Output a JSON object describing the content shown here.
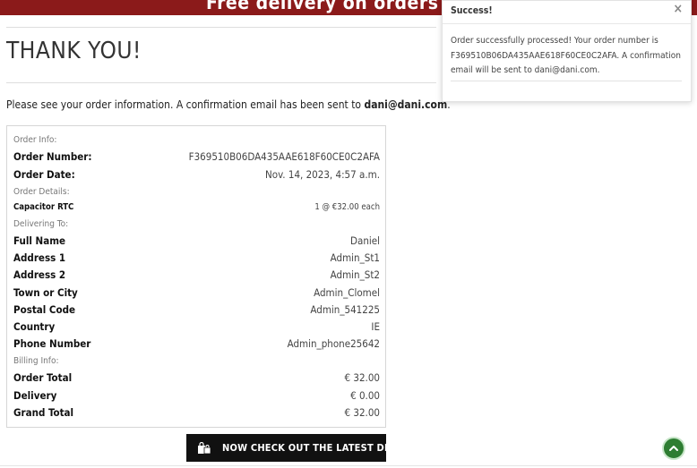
{
  "banner": {
    "text": "Free delivery on orders over €"
  },
  "header": {
    "title": "THANK YOU!"
  },
  "intro": {
    "text": "Please see your order information. A confirmation email has been sent to ",
    "email": "dani@dani.com",
    "suffix": "."
  },
  "order": {
    "order_info_heading": "Order Info:",
    "order_number_label": "Order Number:",
    "order_number": "F369510B06DA435AAE618F60CE0C2AFA",
    "order_date_label": "Order Date:",
    "order_date": "Nov. 14, 2023, 4:57 a.m.",
    "order_details_heading": "Order Details:",
    "items": [
      {
        "name": "Capacitor RTC",
        "detail": "1 @ €32.00 each"
      }
    ],
    "delivering_heading": "Delivering To:",
    "delivery": [
      {
        "label": "Full Name",
        "value": "Daniel"
      },
      {
        "label": "Address 1",
        "value": "Admin_St1"
      },
      {
        "label": "Address 2",
        "value": "Admin_St2"
      },
      {
        "label": "Town or City",
        "value": "Admin_Clomel"
      },
      {
        "label": "Postal Code",
        "value": "Admin_541225"
      },
      {
        "label": "Country",
        "value": "IE"
      },
      {
        "label": "Phone Number",
        "value": "Admin_phone25642"
      }
    ],
    "billing_heading": "Billing Info:",
    "billing": [
      {
        "label": "Order Total",
        "value": "€ 32.00"
      },
      {
        "label": "Delivery",
        "value": "€ 0.00"
      },
      {
        "label": "Grand Total",
        "value": "€ 32.00"
      }
    ]
  },
  "deals_button": {
    "label": "NOW CHECK OUT THE LATEST DEALS!",
    "icon": "shopping-bags-icon"
  },
  "toast": {
    "title": "Success!",
    "close": "×",
    "message": "Order successfully processed! Your order number is F369510B06DA435AAE618F60CE0C2AFA. A confirmation email will be sent to dani@dani.com."
  },
  "colors": {
    "banner": "#8b1a1a",
    "button": "#111111",
    "scroll_top": "#2e7d32"
  }
}
